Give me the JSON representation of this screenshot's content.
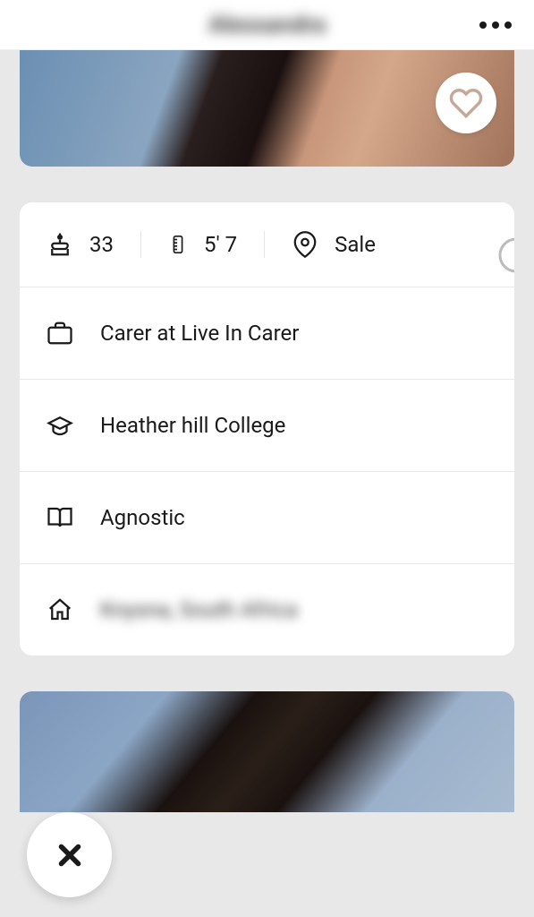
{
  "header": {
    "title": "Alessandra"
  },
  "stats": {
    "age": "33",
    "height": "5' 7",
    "location": "Sale"
  },
  "details": {
    "work": "Carer at Live In Carer",
    "education": "Heather hill College",
    "religion": "Agnostic",
    "hometown": "Knysna, South Africa"
  }
}
